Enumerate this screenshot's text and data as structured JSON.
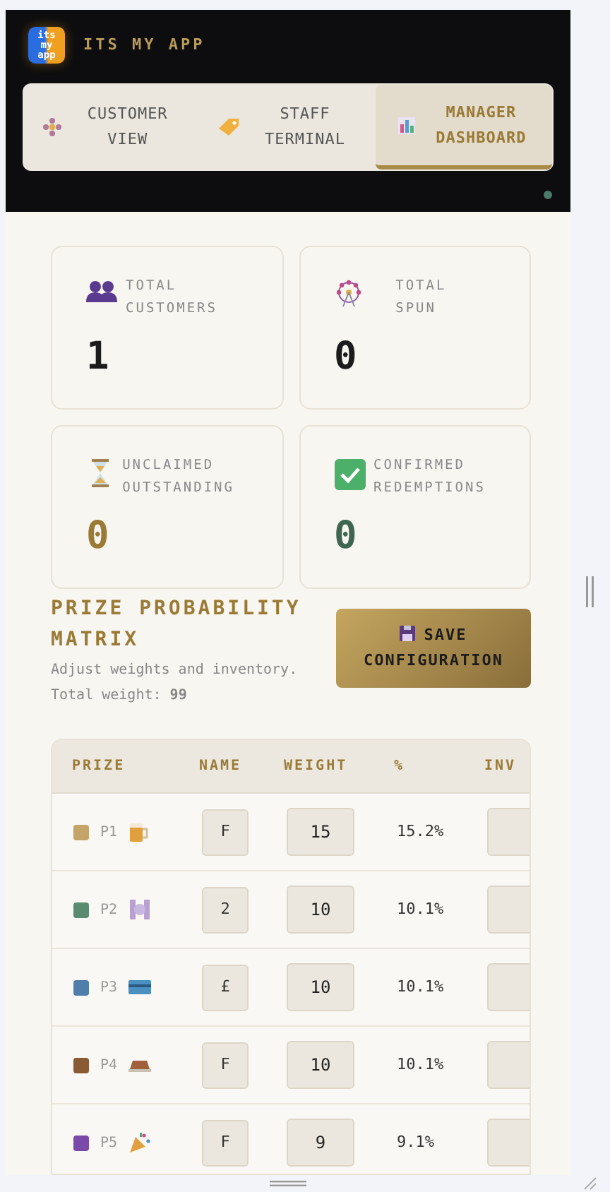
{
  "header": {
    "logo": {
      "lines": [
        "its",
        "my",
        "app"
      ]
    },
    "title": "ITS MY APP"
  },
  "tabs": [
    {
      "label": "CUSTOMER VIEW",
      "selected": false
    },
    {
      "label": "STAFF TERMINAL",
      "selected": false
    },
    {
      "label": "MANAGER DASHBOARD",
      "selected": true
    }
  ],
  "stats": [
    {
      "label": "TOTAL CUSTOMERS",
      "value": "1",
      "color": "#1c1c1c"
    },
    {
      "label": "TOTAL SPUN",
      "value": "0",
      "color": "#1c1c1c"
    },
    {
      "label": "UNCLAIMED OUTSTANDING",
      "value": "0",
      "color": "#9a7a35"
    },
    {
      "label": "CONFIRMED REDEMPTIONS",
      "value": "0",
      "color": "#3e6650"
    }
  ],
  "matrix": {
    "title": "PRIZE PROBABILITY MATRIX",
    "subtitle": "Adjust weights and inventory. Total weight: **99**",
    "save_button": "SAVE CONFIGURATION"
  },
  "table": {
    "columns": [
      "PRIZE",
      "NAME",
      "WEIGHT",
      "%",
      "INV"
    ],
    "rows": [
      {
        "color": "#c4a468",
        "prize": "P1",
        "name": "F",
        "weight": "15",
        "percent": "15.2%"
      },
      {
        "color": "#5a8a70",
        "prize": "P2",
        "name": "2",
        "weight": "10",
        "percent": "10.1%"
      },
      {
        "color": "#4f7ea8",
        "prize": "P3",
        "name": "£",
        "weight": "10",
        "percent": "10.1%"
      },
      {
        "color": "#8a5a35",
        "prize": "P4",
        "name": "F",
        "weight": "10",
        "percent": "10.1%"
      },
      {
        "color": "#7a4aa8",
        "prize": "P5",
        "name": "F",
        "weight": "9",
        "percent": "9.1%"
      }
    ]
  }
}
